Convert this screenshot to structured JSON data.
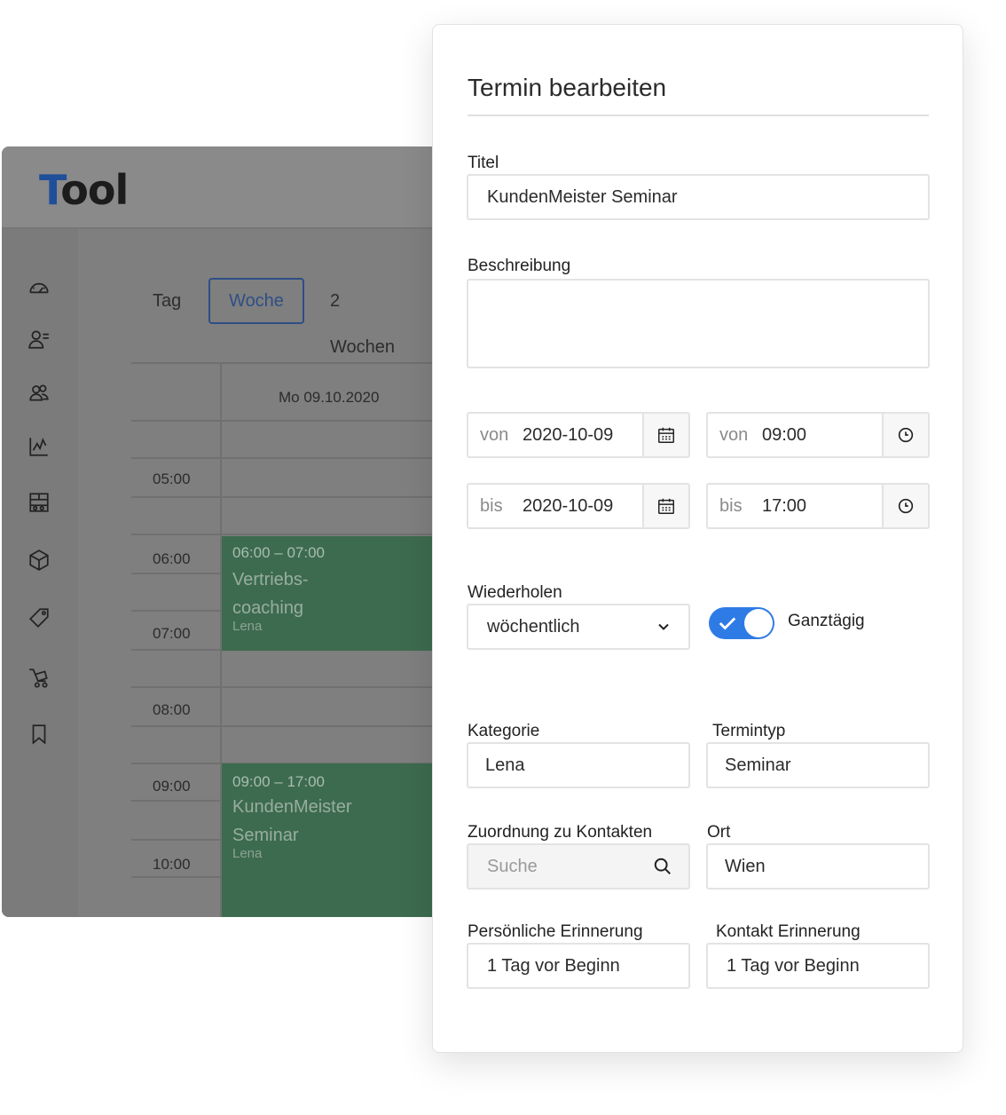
{
  "app": {
    "logo_first": "T",
    "logo_rest": "ool",
    "view_tabs": [
      "Tag",
      "Woche",
      "2 Wochen"
    ],
    "active_tab": "Woche",
    "day_header": "Mo 09.10.2020",
    "hours": [
      "05:00",
      "06:00",
      "07:00",
      "08:00",
      "09:00",
      "10:00"
    ],
    "events": [
      {
        "time": "06:00 – 07:00",
        "title_line1": "Vertriebs-",
        "title_line2": "coaching",
        "person": "Lena"
      },
      {
        "time": "09:00 – 17:00",
        "title_line1": "KundenMeister",
        "title_line2": "Seminar",
        "person": "Lena"
      }
    ],
    "sidebar_icons": [
      "dashboard-icon",
      "contacts-list-icon",
      "groups-icon",
      "chart-icon",
      "board-icon",
      "package-icon",
      "tag-icon",
      "cart-icon",
      "bookmark-icon"
    ]
  },
  "modal": {
    "title": "Termin bearbeiten",
    "titel_label": "Titel",
    "titel_value": "KundenMeister Seminar",
    "beschreibung_label": "Beschreibung",
    "beschreibung_value": "",
    "von_prefix": "von",
    "bis_prefix": "bis",
    "start_date": "2020-10-09",
    "end_date": "2020-10-09",
    "start_time": "09:00",
    "end_time": "17:00",
    "wiederholen_label": "Wiederholen",
    "wiederholen_value": "wöchentlich",
    "ganztaegig_label": "Ganztägig",
    "ganztaegig_on": true,
    "kategorie_label": "Kategorie",
    "kategorie_value": "Lena",
    "termintyp_label": "Termintyp",
    "termintyp_value": "Seminar",
    "kontakte_label": "Zuordnung zu Kontakten",
    "kontakte_placeholder": "Suche",
    "ort_label": "Ort",
    "ort_value": "Wien",
    "pers_erinnerung_label": "Persönliche Erinnerung",
    "pers_erinnerung_value": "1 Tag vor Beginn",
    "kontakt_erinnerung_label": "Kontakt Erinnerung",
    "kontakt_erinnerung_value": "1 Tag vor Beginn"
  },
  "colors": {
    "accent": "#2f7be6",
    "event_green": "#3d6b4f",
    "overlay_gray": "#7f7f7f",
    "logo_blue": "#1f4f9a"
  }
}
